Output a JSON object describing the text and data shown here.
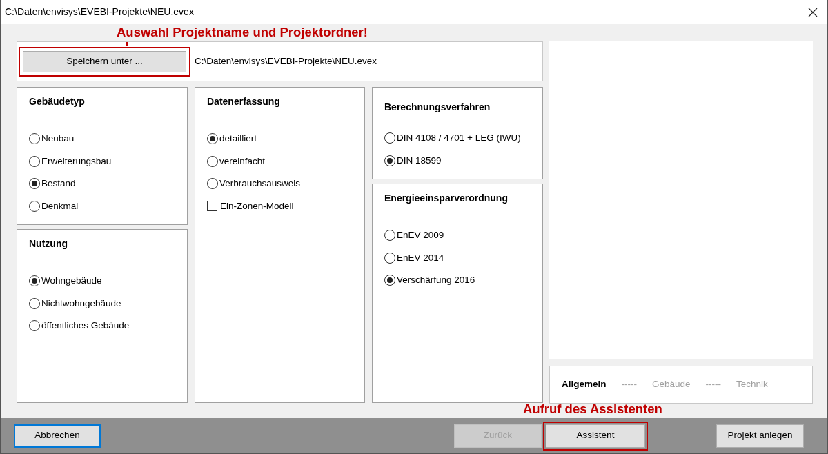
{
  "window": {
    "title": "C:\\Daten\\envisys\\EVEBI-Projekte\\NEU.evex"
  },
  "save_section": {
    "annotation": "Auswahl Projektname und Projektordner!",
    "button": "Speichern unter ...",
    "highlighted": true,
    "path": "C:\\Daten\\envisys\\EVEBI-Projekte\\NEU.evex"
  },
  "columns": [
    {
      "groups": [
        {
          "title": "Gebäudetyp",
          "options": [
            {
              "kind": "radio",
              "label": "Neubau",
              "selected": false
            },
            {
              "kind": "radio",
              "label": "Erweiterungsbau",
              "selected": false
            },
            {
              "kind": "radio",
              "label": "Bestand",
              "selected": true
            },
            {
              "kind": "radio",
              "label": "Denkmal",
              "selected": false
            }
          ]
        },
        {
          "title": "Nutzung",
          "options": [
            {
              "kind": "radio",
              "label": "Wohngebäude",
              "selected": true
            },
            {
              "kind": "radio",
              "label": "Nichtwohngebäude",
              "selected": false
            },
            {
              "kind": "radio",
              "label": "öffentliches Gebäude",
              "selected": false
            }
          ]
        }
      ]
    },
    {
      "groups": [
        {
          "title": "Datenerfassung",
          "options": [
            {
              "kind": "radio",
              "label": "detailliert",
              "selected": true
            },
            {
              "kind": "radio",
              "label": "vereinfacht",
              "selected": false
            },
            {
              "kind": "radio",
              "label": "Verbrauchsausweis",
              "selected": false
            },
            {
              "kind": "checkbox",
              "label": "Ein-Zonen-Modell",
              "checked": false
            }
          ]
        }
      ]
    },
    {
      "groups": [
        {
          "title": "Berechnungsverfahren",
          "options": [
            {
              "kind": "radio",
              "label": "DIN 4108 / 4701 + LEG (IWU)",
              "selected": false
            },
            {
              "kind": "radio",
              "label": "DIN 18599",
              "selected": true
            }
          ]
        },
        {
          "title": "Energieeinsparverordnung",
          "options": [
            {
              "kind": "radio",
              "label": "EnEV 2009",
              "selected": false
            },
            {
              "kind": "radio",
              "label": "EnEV 2014",
              "selected": false
            },
            {
              "kind": "radio",
              "label": "Verschärfung 2016",
              "selected": true
            }
          ]
        }
      ]
    }
  ],
  "steps": [
    {
      "kind": "step",
      "label": "Allgemein",
      "active": true
    },
    {
      "kind": "separator",
      "label": "-----"
    },
    {
      "kind": "step",
      "label": "Gebäude",
      "active": false
    },
    {
      "kind": "separator",
      "label": "-----"
    },
    {
      "kind": "step",
      "label": "Technik",
      "active": false
    }
  ],
  "footer": {
    "annotation": "Aufruf des Assistenten",
    "buttons": [
      {
        "label": "Abbrechen",
        "disabled": false,
        "focused": true,
        "highlighted": false
      },
      {
        "label": "Zurück",
        "disabled": true,
        "focused": false,
        "highlighted": false
      },
      {
        "label": "Assistent",
        "disabled": false,
        "focused": false,
        "highlighted": true
      },
      {
        "label": "Projekt anlegen",
        "disabled": false,
        "focused": false,
        "highlighted": false
      }
    ]
  }
}
